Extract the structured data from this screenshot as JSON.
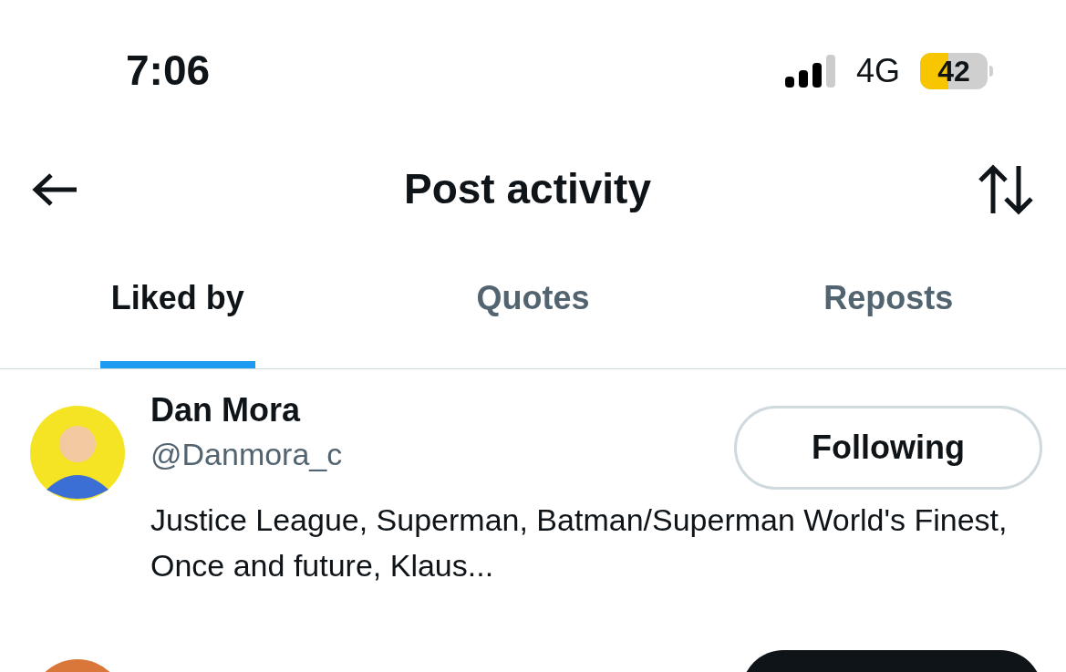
{
  "status_bar": {
    "time": "7:06",
    "network": "4G",
    "battery": "42"
  },
  "header": {
    "title": "Post activity"
  },
  "tabs": [
    {
      "label": "Liked by",
      "selected": true
    },
    {
      "label": "Quotes",
      "selected": false
    },
    {
      "label": "Reposts",
      "selected": false
    }
  ],
  "users": [
    {
      "name": "Dan Mora",
      "handle": "@Danmora_c",
      "bio": "Justice League, Superman, Batman/Superman World's Finest, Once and future, Klaus...",
      "button": "Following",
      "following": true
    },
    {
      "following": false
    }
  ]
}
